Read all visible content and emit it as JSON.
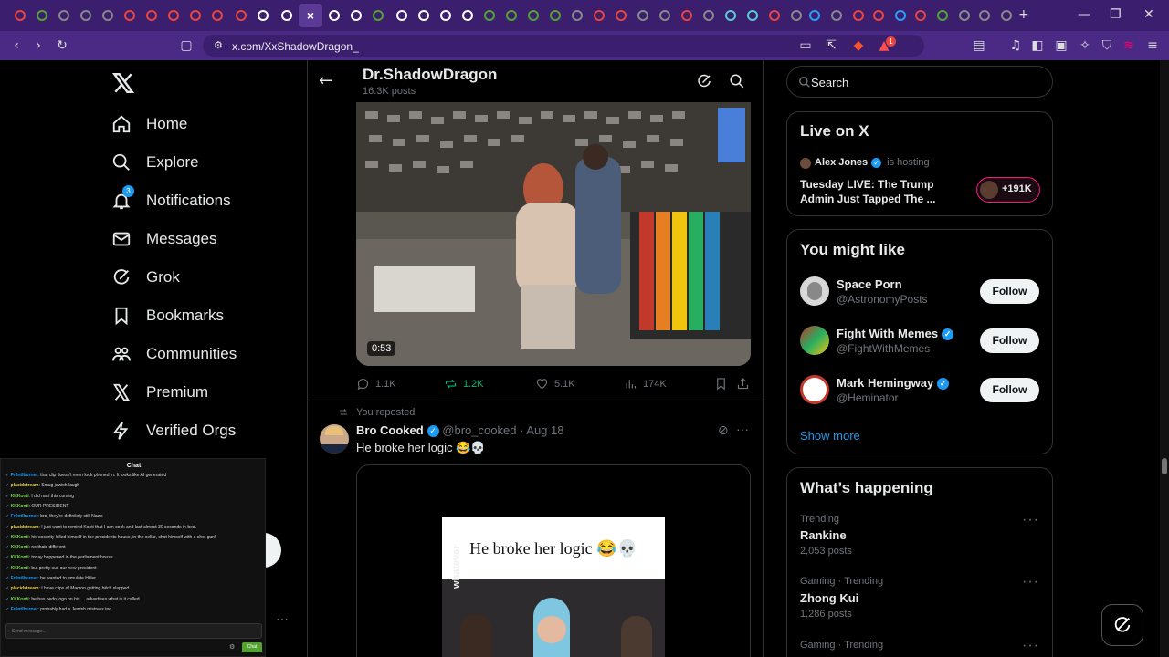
{
  "browser": {
    "active_tab_label": "×",
    "url": "x.com/XxShadowDragon_",
    "notification_badge": "1",
    "window_controls": {
      "minimize": "—",
      "maximize": "❐",
      "close": "✕"
    },
    "new_tab": "+"
  },
  "sidebar": {
    "items": [
      {
        "label": "Home",
        "icon": "home-icon"
      },
      {
        "label": "Explore",
        "icon": "search-icon"
      },
      {
        "label": "Notifications",
        "icon": "bell-icon",
        "badge": "3"
      },
      {
        "label": "Messages",
        "icon": "mail-icon"
      },
      {
        "label": "Grok",
        "icon": "grok-icon"
      },
      {
        "label": "Bookmarks",
        "icon": "bookmark-icon"
      },
      {
        "label": "Communities",
        "icon": "communities-icon"
      },
      {
        "label": "Premium",
        "icon": "x-icon"
      },
      {
        "label": "Verified Orgs",
        "icon": "lightning-icon"
      }
    ],
    "more_dots": "···"
  },
  "profile_header": {
    "name": "Dr.ShadowDragon",
    "posts": "16.3K posts"
  },
  "post1": {
    "duration": "0:53",
    "replies": "1.1K",
    "reposts": "1.2K",
    "likes": "5.1K",
    "views": "174K"
  },
  "post2": {
    "repost_label": "You reposted",
    "author": "Bro Cooked",
    "handle": "@bro_cooked",
    "date": "· Aug 18",
    "text": "He broke her logic 😂💀",
    "image_caption": "He broke her logic 😂💀",
    "watermark": "whatever"
  },
  "right": {
    "search_placeholder": "Search",
    "live": {
      "title": "Live on X",
      "host": "Alex Jones",
      "hosting": "is hosting",
      "stream_title": "Tuesday LIVE: The Trump Admin Just Tapped The ...",
      "listeners": "+191K"
    },
    "you_might_like": {
      "title": "You might like",
      "users": [
        {
          "name": "Space Porn",
          "handle": "@AstronomyPosts",
          "verified": false
        },
        {
          "name": "Fight With Memes",
          "handle": "@FightWithMemes",
          "verified": true
        },
        {
          "name": "Mark Hemingway",
          "handle": "@Heminator",
          "verified": true
        }
      ],
      "follow_label": "Follow",
      "show_more": "Show more"
    },
    "whats_happening": {
      "title": "What’s happening",
      "trends": [
        {
          "meta": "Trending",
          "name": "Rankine",
          "count": "2,053 posts"
        },
        {
          "meta": "Gaming · Trending",
          "name": "Zhong Kui",
          "count": "1,286 posts"
        },
        {
          "meta": "Gaming · Trending",
          "name": "",
          "count": ""
        }
      ]
    }
  },
  "chat": {
    "title": "Chat",
    "input_placeholder": "Send message...",
    "send_label": "Chat",
    "messages": [
      {
        "user": "Fr0ntIburner",
        "text": "that clip doesn't even look phoned in. It looks like AI generated",
        "color": "#1d9bf0"
      },
      {
        "user": "placidstream",
        "text": "Smug jewish laugh",
        "color": "#e8d44d"
      },
      {
        "user": "KKKonti",
        "text": "I did nazi this coming",
        "color": "#7ed957"
      },
      {
        "user": "KKKonti",
        "text": "OUR PRESIDENT",
        "color": "#7ed957"
      },
      {
        "user": "Fr0ntIburner",
        "text": "bro, they're definitely still Nazis",
        "color": "#1d9bf0"
      },
      {
        "user": "placidstream",
        "text": "I just want to remind Konti that I can cook and last almost 30 seconds in bed.",
        "color": "#e8d44d"
      },
      {
        "user": "KKKonti",
        "text": "his security killed himself in the presidents house, in the cellar, shot himself with a shot gun!",
        "color": "#7ed957"
      },
      {
        "user": "KKKonti",
        "text": "no thats different",
        "color": "#7ed957"
      },
      {
        "user": "KKKonti",
        "text": "today happened in the parliament house",
        "color": "#7ed957"
      },
      {
        "user": "KKKonti",
        "text": "but pretty sus our new president",
        "color": "#7ed957"
      },
      {
        "user": "Fr0ntIburner",
        "text": "he wanted to emulate Hitler",
        "color": "#1d9bf0"
      },
      {
        "user": "placidstream",
        "text": "I have clips of Macron getting bitch slapped",
        "color": "#e8d44d"
      },
      {
        "user": "KKKonti",
        "text": "he has pedo logo on his ... advertises what is it called",
        "color": "#7ed957"
      },
      {
        "user": "Fr0ntIburner",
        "text": "probably had a Jewish mistress too",
        "color": "#1d9bf0"
      }
    ]
  },
  "colors": {
    "accent": "#1d9bf0",
    "repost_green": "#00ba7c",
    "browser_purple": "#3b1f6e"
  }
}
